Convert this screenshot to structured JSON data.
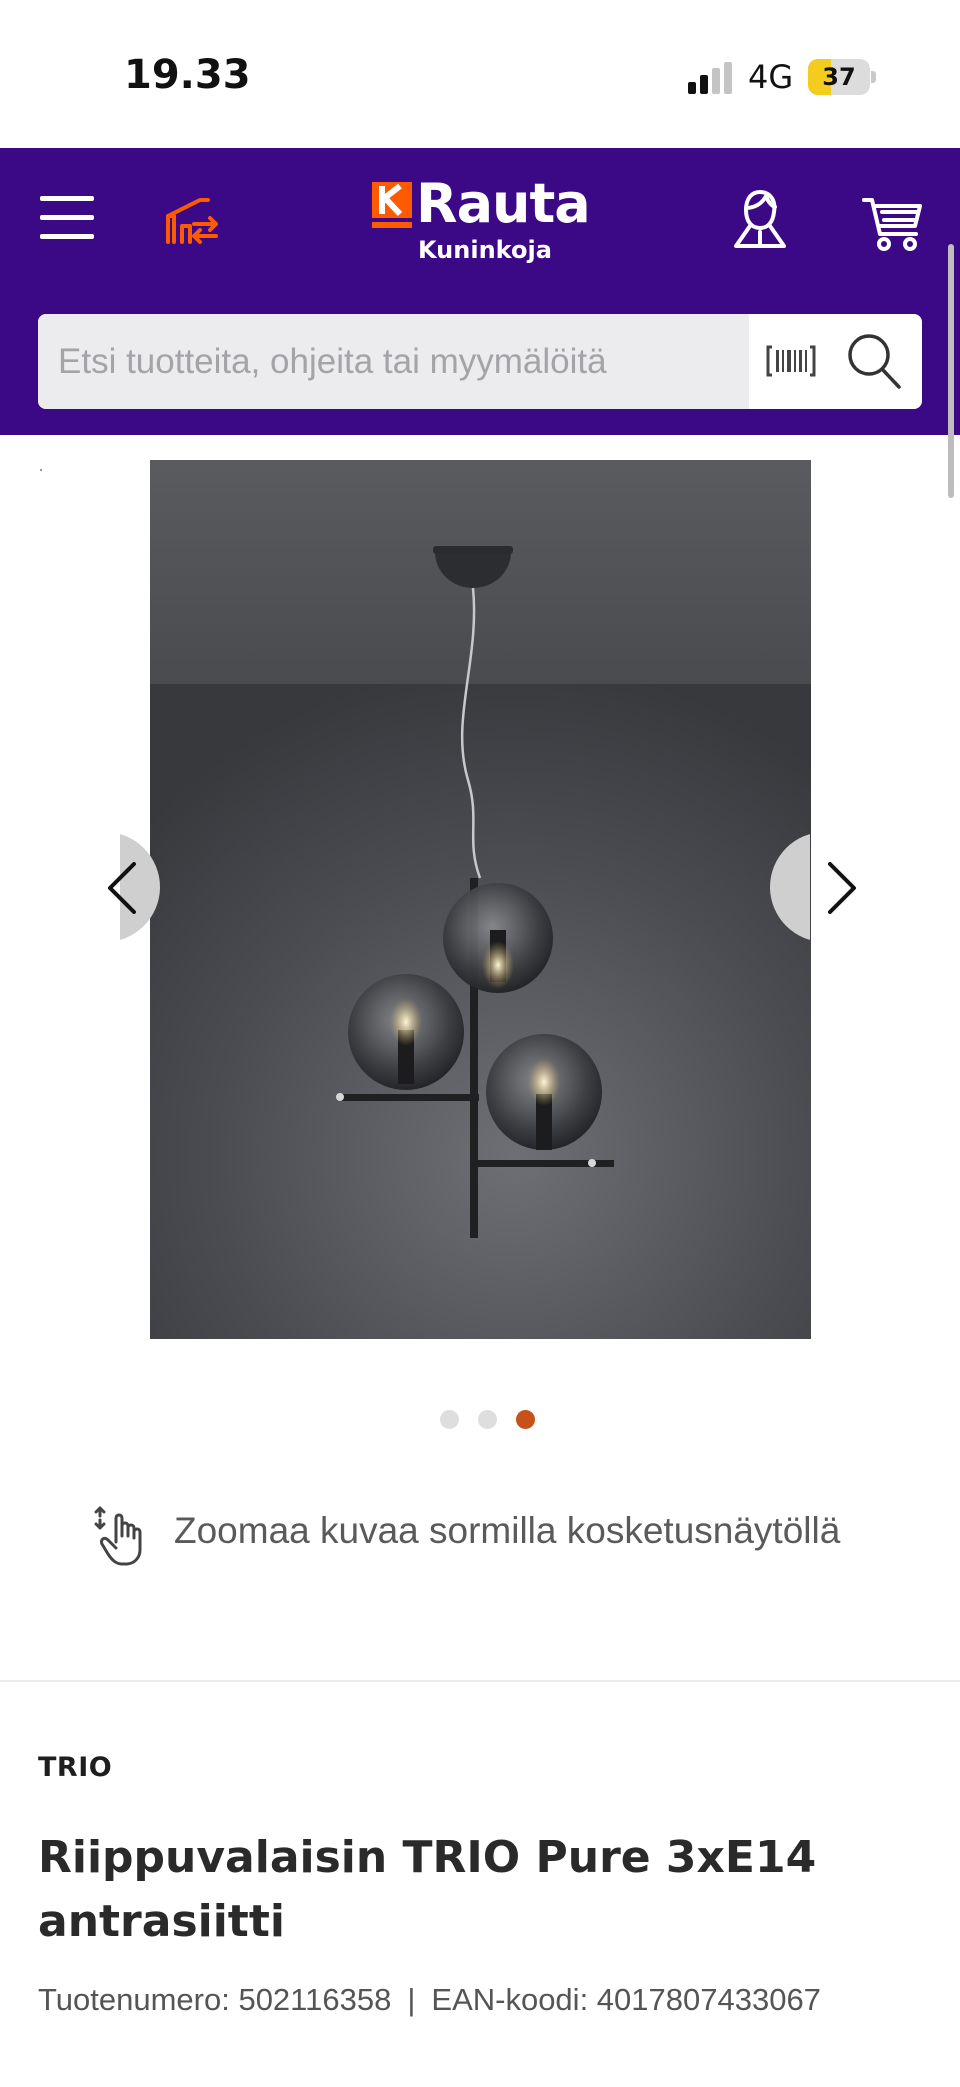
{
  "status_bar": {
    "time": "19.33",
    "network": "4G",
    "battery_level": "37",
    "battery_fraction": 0.37,
    "battery_color": "#f4cc1d"
  },
  "header": {
    "background_color": "#3c0986",
    "accent_color": "#ff5a00",
    "menu_icon": "hamburger-menu-icon",
    "compare_icon": "compare-icon",
    "logo": {
      "brand": "Rauta",
      "store_name": "Kuninkoja"
    },
    "account_icon": "user-account-icon",
    "cart_icon": "shopping-cart-icon"
  },
  "search": {
    "placeholder": "Etsi tuotteita, ohjeita tai myymälöitä",
    "barcode_icon": "barcode-scan-icon",
    "search_icon": "search-icon"
  },
  "gallery": {
    "prev_icon": "chevron-left-icon",
    "next_icon": "chevron-right-icon",
    "image_count": 3,
    "active_index": 2,
    "active_dot_color": "#c8501a",
    "zoom_hint": "Zoomaa kuvaa sormilla kosketusnäytöllä",
    "zoom_icon": "pinch-zoom-hand-icon"
  },
  "product": {
    "brand": "TRIO",
    "title": "Riippuvalaisin TRIO Pure 3xE14 antrasiitti",
    "sku_label": "Tuotenumero: 502116358",
    "separator": "|",
    "ean_label": "EAN-koodi: 4017807433067"
  }
}
